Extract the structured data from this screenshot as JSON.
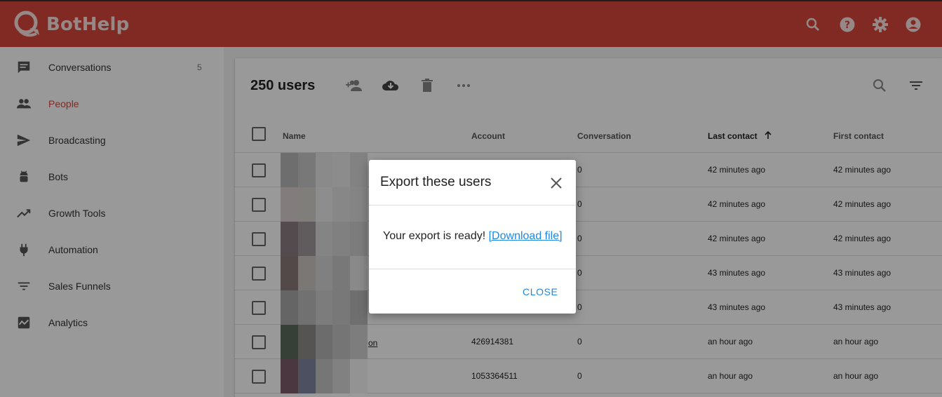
{
  "app": {
    "brand": "BotHelp",
    "accent_color": "#d8463b",
    "link_color": "#1e88e5"
  },
  "header": {
    "icons": [
      "search-icon",
      "help-icon",
      "settings-icon",
      "account-icon"
    ]
  },
  "sidebar": {
    "items": [
      {
        "label": "Conversations",
        "icon": "chat-icon",
        "count": "5"
      },
      {
        "label": "People",
        "icon": "people-icon",
        "active": true
      },
      {
        "label": "Broadcasting",
        "icon": "send-icon"
      },
      {
        "label": "Bots",
        "icon": "android-icon"
      },
      {
        "label": "Growth Tools",
        "icon": "trending-icon"
      },
      {
        "label": "Automation",
        "icon": "plug-icon"
      },
      {
        "label": "Sales Funnels",
        "icon": "filter-icon"
      },
      {
        "label": "Analytics",
        "icon": "chart-icon"
      }
    ]
  },
  "main": {
    "title": "250 users",
    "toolbar": [
      "add-user-icon",
      "download-cloud-icon",
      "delete-icon",
      "more-icon",
      "search-icon",
      "filter-icon"
    ],
    "columns": {
      "name": "Name",
      "account": "Account",
      "conversation": "Conversation",
      "last_contact": "Last contact",
      "first_contact": "First contact"
    },
    "rows": [
      {
        "name": "",
        "account": "",
        "conversation": "0",
        "last_contact": "42 minutes ago",
        "first_contact": "42 minutes ago"
      },
      {
        "name": "",
        "account": "",
        "conversation": "0",
        "last_contact": "42 minutes ago",
        "first_contact": "42 minutes ago"
      },
      {
        "name": "",
        "account": "",
        "conversation": "0",
        "last_contact": "42 minutes ago",
        "first_contact": "42 minutes ago"
      },
      {
        "name": "",
        "account": "",
        "conversation": "0",
        "last_contact": "43 minutes ago",
        "first_contact": "43 minutes ago"
      },
      {
        "name": "",
        "account": "",
        "conversation": "0",
        "last_contact": "43 minutes ago",
        "first_contact": "43 minutes ago"
      },
      {
        "name": "on",
        "account": "426914381",
        "conversation": "0",
        "last_contact": "an hour ago",
        "first_contact": "an hour ago"
      },
      {
        "name": "",
        "account": "1053364511",
        "conversation": "0",
        "last_contact": "an hour ago",
        "first_contact": "an hour ago"
      }
    ]
  },
  "dialog": {
    "title": "Export these users",
    "message": "Your export is ready!",
    "link": "[Download file]",
    "close_button": "CLOSE"
  }
}
